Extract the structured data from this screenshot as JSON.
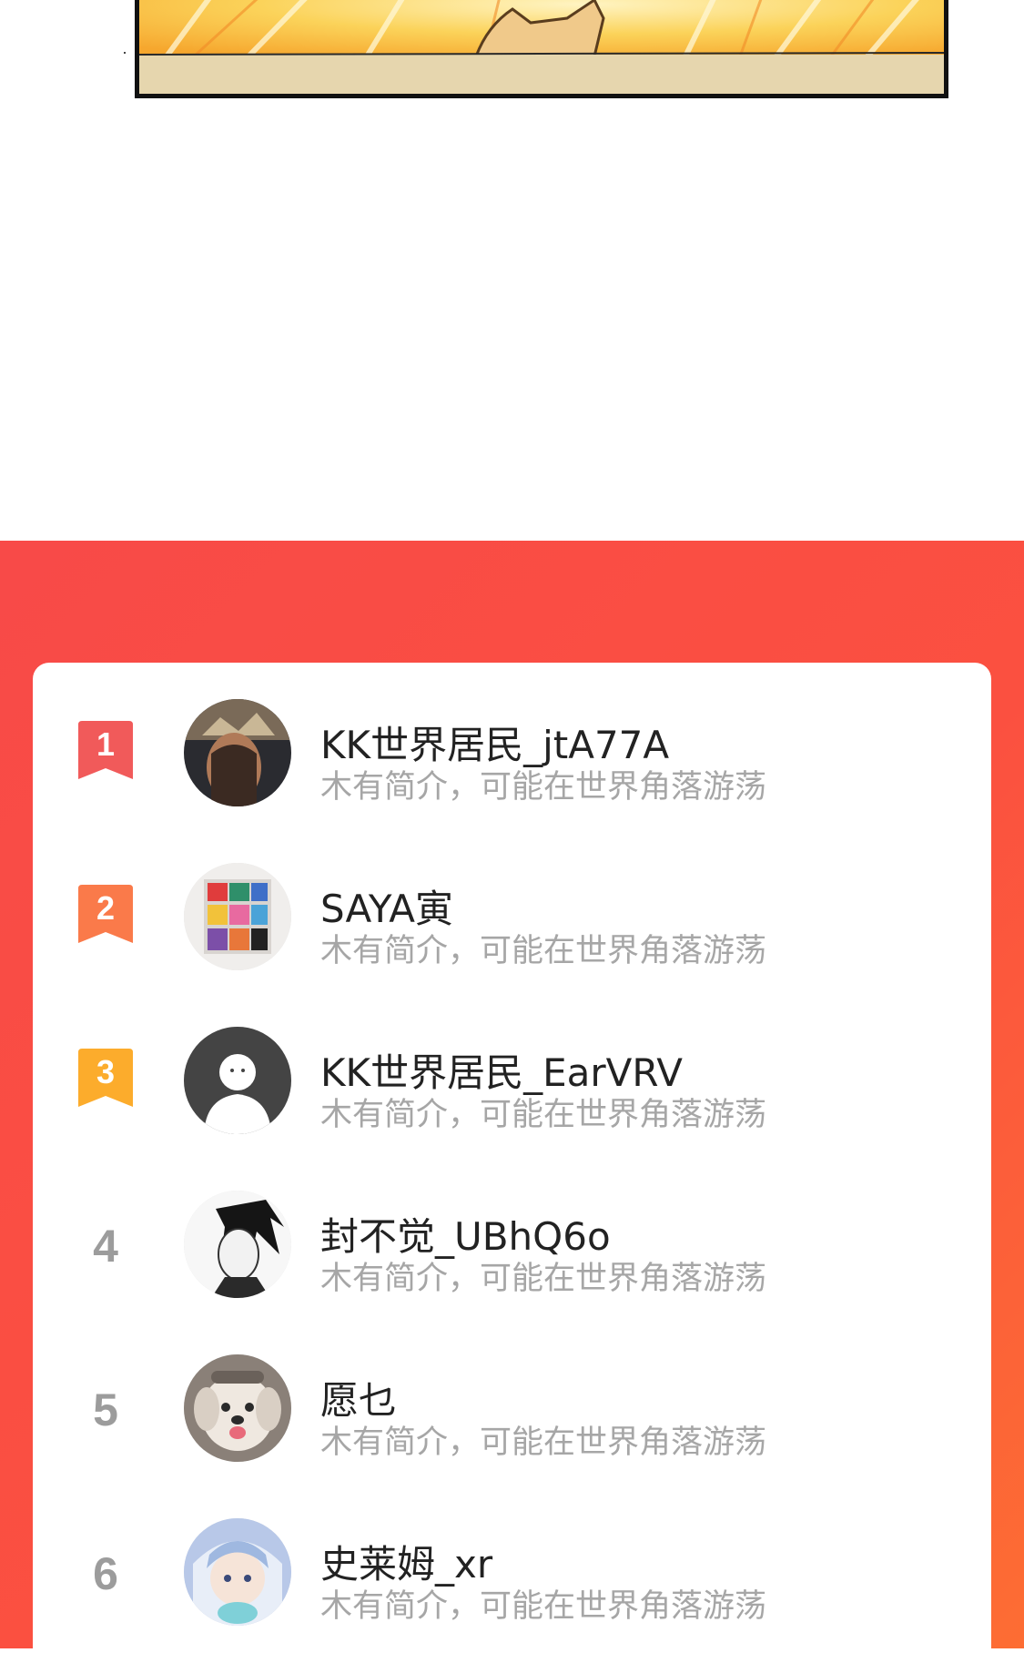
{
  "ranking": {
    "accent_colors": {
      "section_start": "#f84a48",
      "section_end": "#fd6d33",
      "rank1": "#f15a5a",
      "rank2": "#fa7a4a",
      "rank3": "#fcac2c",
      "rank_plain": "#9c9c9c"
    },
    "items": [
      {
        "rank": "1",
        "name": "KK世界居民_jtA77A",
        "bio": "木有简介，可能在世界角落游荡"
      },
      {
        "rank": "2",
        "name": "SAYA寅",
        "bio": "木有简介，可能在世界角落游荡"
      },
      {
        "rank": "3",
        "name": "KK世界居民_EarVRV",
        "bio": "木有简介，可能在世界角落游荡"
      },
      {
        "rank": "4",
        "name": "封不觉_UBhQ6o",
        "bio": "木有简介，可能在世界角落游荡"
      },
      {
        "rank": "5",
        "name": "愿乜",
        "bio": "木有简介，可能在世界角落游荡"
      },
      {
        "rank": "6",
        "name": "史莱姆_xr",
        "bio": "木有简介，可能在世界角落游荡"
      }
    ]
  }
}
